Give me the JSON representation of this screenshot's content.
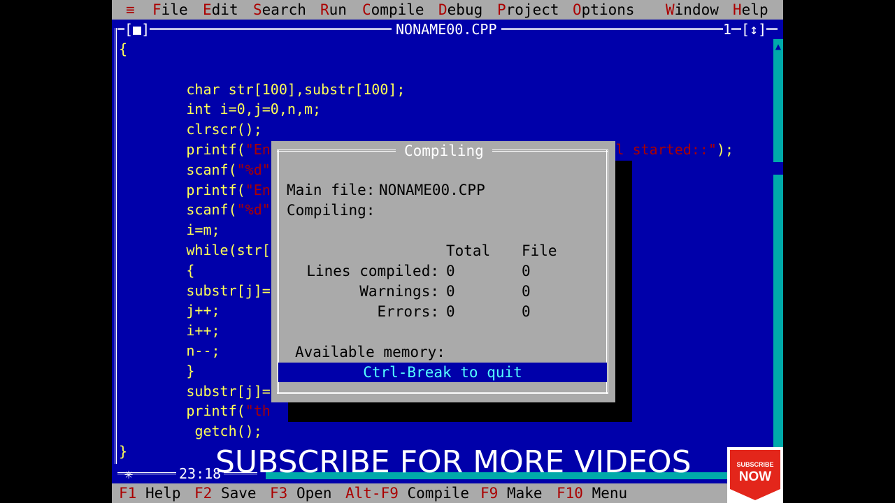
{
  "menubar": {
    "system_icon": "≡",
    "items": [
      {
        "hot": "F",
        "rest": "ile"
      },
      {
        "hot": "E",
        "rest": "dit"
      },
      {
        "hot": "S",
        "rest": "earch"
      },
      {
        "hot": "R",
        "rest": "un"
      },
      {
        "hot": "C",
        "rest": "ompile"
      },
      {
        "hot": "D",
        "rest": "ebug"
      },
      {
        "hot": "P",
        "rest": "roject"
      },
      {
        "hot": "O",
        "rest": "ptions"
      },
      {
        "hot": "W",
        "rest": "indow"
      },
      {
        "hot": "H",
        "rest": "elp"
      }
    ]
  },
  "editor": {
    "filename": "NONAME00.CPP",
    "window_number": "1",
    "close_button": "[■]",
    "zoom_button": "[↕]",
    "cursor_position": "23:18",
    "code_lines": [
      {
        "text": "{",
        "indent": 0
      },
      {
        "text": "",
        "indent": 0
      },
      {
        "text": "char str[100],substr[100];",
        "indent": 8
      },
      {
        "text": "int i=0,j=0,n,m;",
        "indent": 8
      },
      {
        "text": "clrscr();",
        "indent": 8
      },
      {
        "pre": "printf(",
        "str": "\"Enter the position from which substring will started::\"",
        "post": ");",
        "indent": 8
      },
      {
        "pre": "scanf(",
        "str": "\"%d\"",
        "post": "",
        "indent": 8
      },
      {
        "pre": "printf(",
        "str": "\"En",
        "post": "",
        "indent": 8
      },
      {
        "pre": "scanf(",
        "str": "\"%d\"",
        "post": "",
        "indent": 8
      },
      {
        "text": "i=m;",
        "indent": 8
      },
      {
        "text": "while(str[",
        "indent": 8
      },
      {
        "text": "{",
        "indent": 8
      },
      {
        "text": "substr[j]=",
        "indent": 8
      },
      {
        "text": "j++;",
        "indent": 8
      },
      {
        "text": "i++;",
        "indent": 8
      },
      {
        "text": "n--;",
        "indent": 8
      },
      {
        "text": "}",
        "indent": 8
      },
      {
        "text": "substr[j]=",
        "indent": 8
      },
      {
        "pre": "printf(",
        "str": "\"th",
        "post": "",
        "indent": 8
      },
      {
        "text": "getch();",
        "indent": 9
      },
      {
        "text": "}",
        "indent": 0
      }
    ]
  },
  "compile_dialog": {
    "title": "Compiling",
    "main_file_label": "Main file:",
    "main_file_value": "NONAME00.CPP",
    "compiling_label": "Compiling:",
    "col_total": "Total",
    "col_file": "File",
    "rows": [
      {
        "label": "Lines compiled:",
        "total": "0",
        "file": "0"
      },
      {
        "label": "Warnings:",
        "total": "0",
        "file": "0"
      },
      {
        "label": "Errors:",
        "total": "0",
        "file": "0"
      }
    ],
    "memory_label": "Available memory:",
    "quit_hint": "Ctrl-Break to quit"
  },
  "statusbar": {
    "items": [
      {
        "key": "F1",
        "label": "Help"
      },
      {
        "key": "F2",
        "label": "Save"
      },
      {
        "key": "F3",
        "label": "Open"
      },
      {
        "key": "Alt-F9",
        "label": "Compile"
      },
      {
        "key": "F9",
        "label": "Make"
      },
      {
        "key": "F10",
        "label": "Menu"
      }
    ]
  },
  "overlay": {
    "caption": "SUBSCRIBE FOR MORE VIDEOS",
    "badge_small": "SUBSCRIBE",
    "badge_big": "NOW"
  },
  "colors": {
    "editor_bg": "#0000aa",
    "code_text": "#ffff55",
    "string_text": "#aa0000",
    "menu_bg": "#aaaaaa",
    "hotkey": "#aa0000",
    "dialog_bg": "#aaaaaa",
    "badge_red": "#e3261b"
  }
}
